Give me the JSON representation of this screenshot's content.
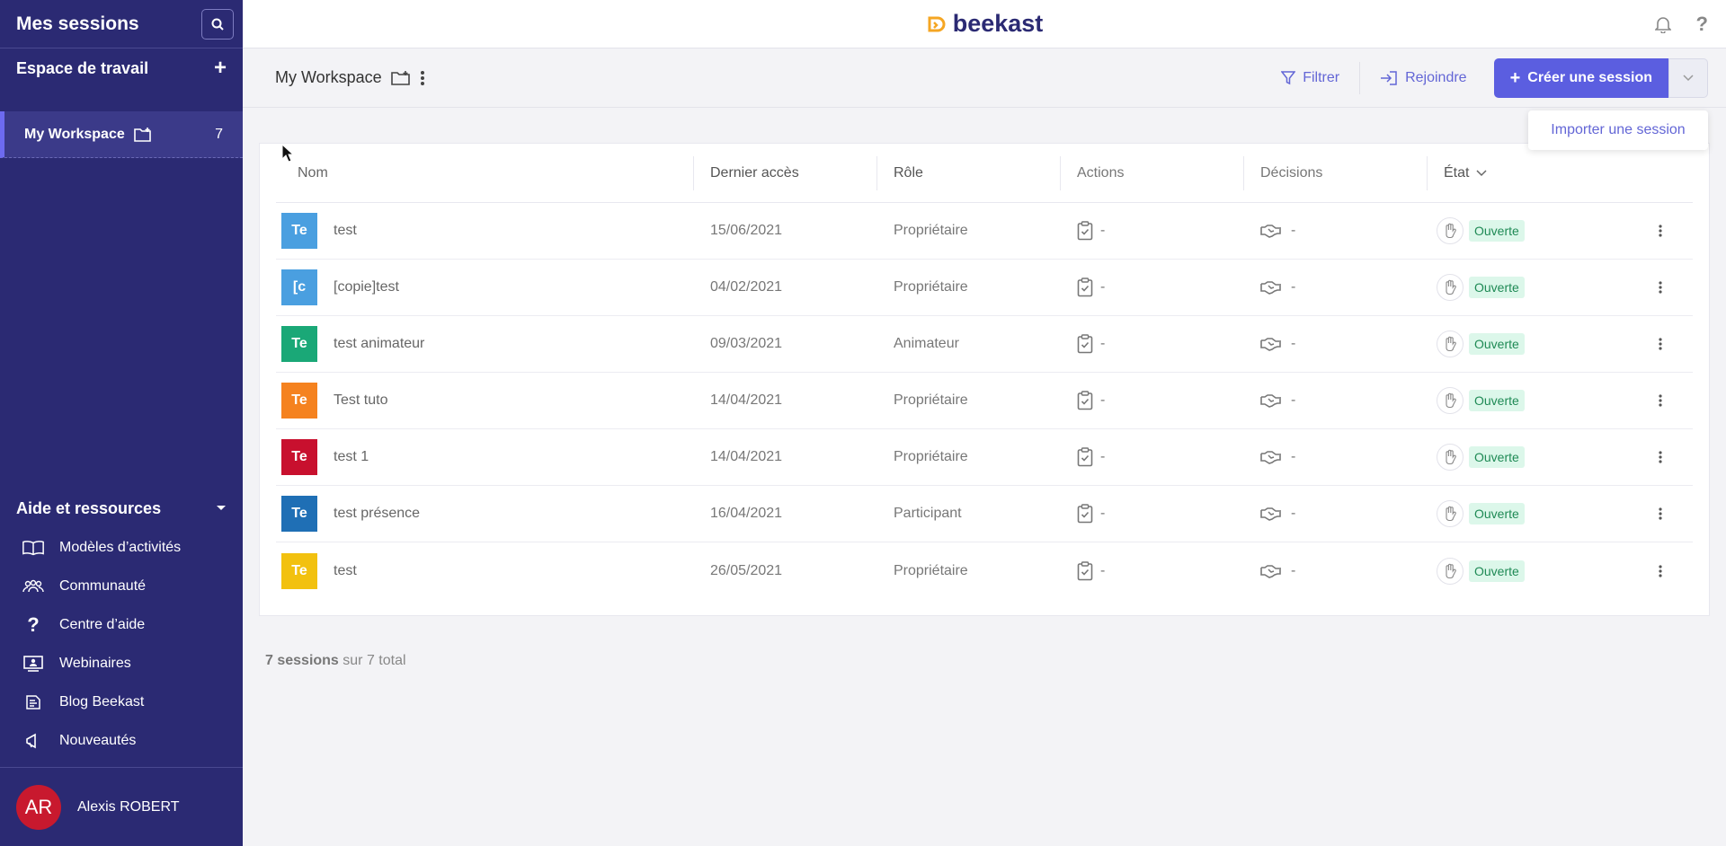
{
  "sidebar": {
    "title": "Mes sessions",
    "workspace_section": "Espace de travail",
    "workspace_item": {
      "label": "My Workspace",
      "count": "7"
    },
    "aide_title": "Aide et ressources",
    "aide_items": [
      {
        "label": "Modèles d’activités",
        "icon": "book-icon"
      },
      {
        "label": "Communauté",
        "icon": "people-icon"
      },
      {
        "label": "Centre d’aide",
        "icon": "question-icon"
      },
      {
        "label": "Webinaires",
        "icon": "webinar-icon"
      },
      {
        "label": "Blog Beekast",
        "icon": "blog-icon"
      },
      {
        "label": "Nouveautés",
        "icon": "megaphone-icon"
      }
    ],
    "user": {
      "initials": "AR",
      "name": "Alexis ROBERT"
    }
  },
  "topbar": {
    "brand": "beekast"
  },
  "subheader": {
    "workspace": "My Workspace",
    "filter_label": "Filtrer",
    "join_label": "Rejoindre",
    "create_label": "Créer une session",
    "import_label": "Importer une session"
  },
  "table": {
    "headers": {
      "name": "Nom",
      "last_access": "Dernier accès",
      "role": "Rôle",
      "actions": "Actions",
      "decisions": "Décisions",
      "state": "État"
    },
    "rows": [
      {
        "abbr": "Te",
        "color": "#4a9fe0",
        "name": "test",
        "date": "15/06/2021",
        "role": "Propriétaire",
        "actions": "-",
        "decisions": "-",
        "state": "Ouverte"
      },
      {
        "abbr": "[c",
        "color": "#4a9fe0",
        "name": "[copie]test",
        "date": "04/02/2021",
        "role": "Propriétaire",
        "actions": "-",
        "decisions": "-",
        "state": "Ouverte"
      },
      {
        "abbr": "Te",
        "color": "#1aa877",
        "name": "test animateur",
        "date": "09/03/2021",
        "role": "Animateur",
        "actions": "-",
        "decisions": "-",
        "state": "Ouverte"
      },
      {
        "abbr": "Te",
        "color": "#f5821f",
        "name": "Test tuto",
        "date": "14/04/2021",
        "role": "Propriétaire",
        "actions": "-",
        "decisions": "-",
        "state": "Ouverte"
      },
      {
        "abbr": "Te",
        "color": "#c8102e",
        "name": "test 1",
        "date": "14/04/2021",
        "role": "Propriétaire",
        "actions": "-",
        "decisions": "-",
        "state": "Ouverte"
      },
      {
        "abbr": "Te",
        "color": "#1f6fb5",
        "name": "test présence",
        "date": "16/04/2021",
        "role": "Participant",
        "actions": "-",
        "decisions": "-",
        "state": "Ouverte"
      },
      {
        "abbr": "Te",
        "color": "#f2c10f",
        "name": "test",
        "date": "26/05/2021",
        "role": "Propriétaire",
        "actions": "-",
        "decisions": "-",
        "state": "Ouverte"
      }
    ]
  },
  "footer": {
    "count": "7 sessions",
    "rest": " sur 7 total"
  }
}
